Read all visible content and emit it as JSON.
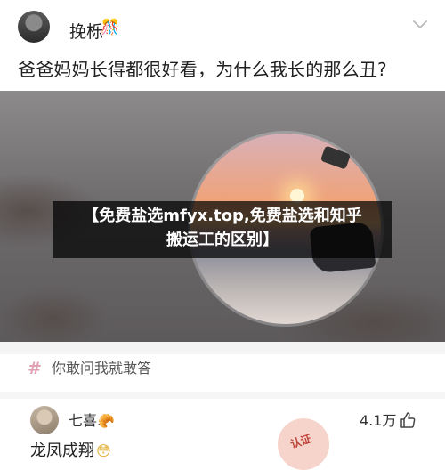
{
  "post": {
    "author_name": "挽栎",
    "author_emoji": "🎊",
    "question": "爸爸妈妈长得都很好看，为什么我长的那么丑?"
  },
  "hero": {
    "watermark_line1": "【免费盐选mfyx.top,免费盐选和知乎",
    "watermark_line2": "搬运工的区别】"
  },
  "tag": {
    "hash_symbol": "#",
    "text": "你敢问我就敢答"
  },
  "comment": {
    "name": "七喜.",
    "name_emoji": "🥐",
    "likes": "4.1万",
    "reply": "龙凤成翔",
    "reply_emoji": "😳",
    "stamp_text": "认证"
  },
  "icons": {
    "expand": "chevron-down-icon",
    "like": "thumbs-up-icon",
    "tag": "hash-icon"
  },
  "colors": {
    "tag_hash": "#e2a0b4",
    "watermark_bg": "#000000"
  }
}
